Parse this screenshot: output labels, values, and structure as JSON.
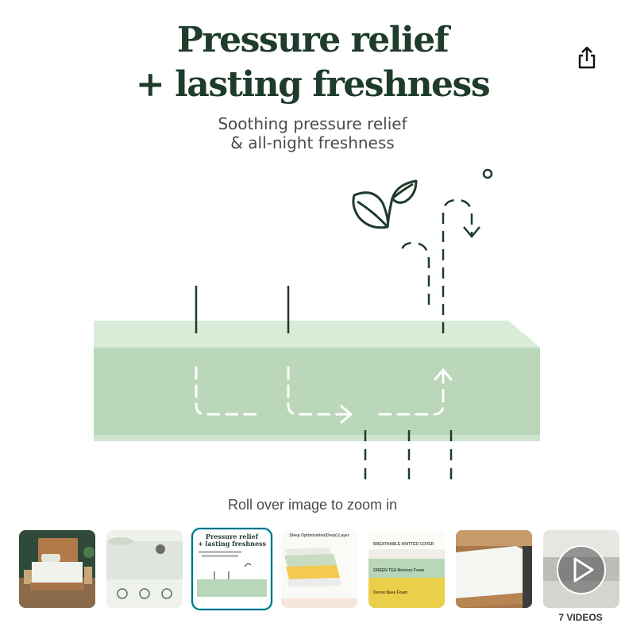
{
  "hero": {
    "headline_line1": "Pressure relief",
    "headline_line2": "+ lasting freshness",
    "subhead_line1": "Soothing pressure relief",
    "subhead_line2": "& all-night freshness"
  },
  "zoom_hint": "Roll over image to zoom in",
  "thumbnails": {
    "items": [
      {
        "name": "bedroom-photo"
      },
      {
        "name": "mattress-features"
      },
      {
        "name": "pressure-relief-diagram",
        "selected": true
      },
      {
        "name": "sleep-optimization-layers"
      },
      {
        "name": "mattress-layers-cross-section"
      },
      {
        "name": "mattress-corner-closeup"
      },
      {
        "name": "videos"
      }
    ],
    "thumb3_text_line1": "Pressure relief",
    "thumb3_text_line2": "+ lasting freshness",
    "thumb4_title": "Sleep Optimization(Deep) Layer",
    "thumb5_label_top": "BREATHABLE KNITTED COVER",
    "thumb5_label_mid": "GREEN TEA Memory Foam",
    "thumb5_label_bot": "Dense Base Foam",
    "video_count_label": "7 VIDEOS"
  },
  "colors": {
    "foam_green": "#b9d7b8",
    "foam_top": "#d7ebd6",
    "headline": "#1f3b2b",
    "selected_border": "#007185"
  },
  "icons": [
    "share-icon",
    "leaf-icon",
    "air-flow-arrow-icon",
    "play-icon"
  ]
}
